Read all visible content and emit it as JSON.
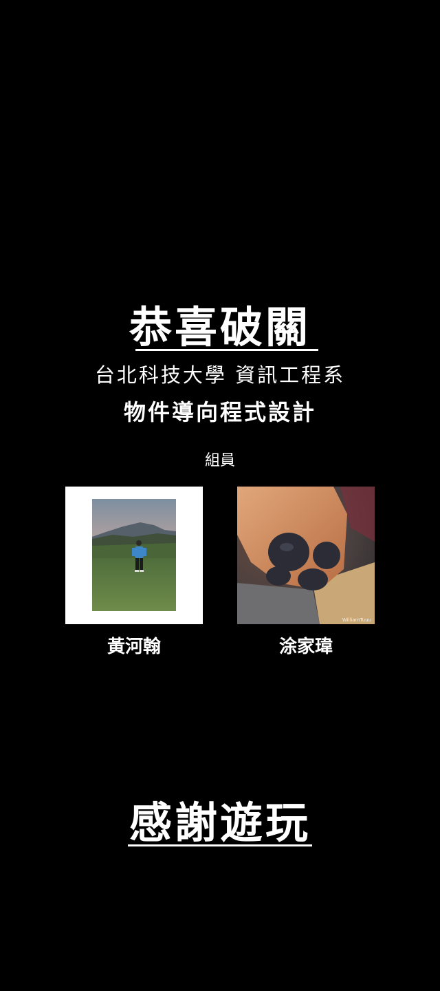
{
  "header": {
    "title": "恭喜破關",
    "school": "台北科技大學 資訊工程系",
    "course": "物件導向程式設計"
  },
  "members": {
    "heading": "組員",
    "list": [
      {
        "name": "黃河翰",
        "photo": "person-on-hill-photo"
      },
      {
        "name": "涂家瑋",
        "photo": "dog-paw-photo",
        "watermark": "WilliamTuuu"
      }
    ]
  },
  "footer": {
    "thanks": "感謝遊玩"
  },
  "colors": {
    "background": "#000000",
    "text": "#ffffff"
  }
}
